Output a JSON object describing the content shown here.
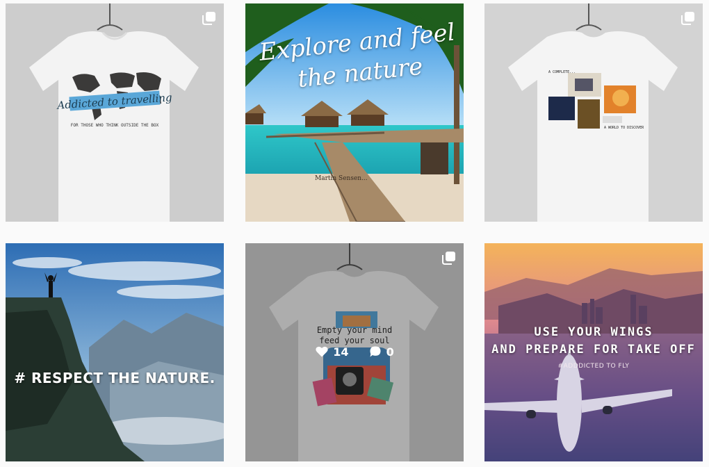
{
  "grid": {
    "posts": [
      {
        "id": "post-1",
        "overlay_title": "Addicted to travelling",
        "overlay_subtitle": "FOR THOSE WHO THINK OUTSIDE THE BOX",
        "multiple_images": true,
        "multi_icon": "carousel-icon"
      },
      {
        "id": "post-2",
        "overlay_title_line1": "Explore and feel",
        "overlay_title_line2": "the nature",
        "credit": "Martin Sensen..."
      },
      {
        "id": "post-3",
        "multiple_images": true,
        "multi_icon": "carousel-icon",
        "tee_caption_top": "A COMPLETE...",
        "tee_caption_bottom": "A WORLD TO DISCOVER"
      },
      {
        "id": "post-4",
        "overlay_text": "# RESPECT  THE NATURE."
      },
      {
        "id": "post-5",
        "multiple_images": true,
        "multi_icon": "carousel-icon",
        "tee_line1": "Empty your mind",
        "tee_line2": "feed your soul",
        "likes": "14",
        "comments": "0",
        "like_icon": "heart-icon",
        "comment_icon": "comment-icon",
        "hovered": true
      },
      {
        "id": "post-6",
        "overlay_line1": "USE YOUR WINGS",
        "overlay_line2": "AND PREPARE FOR TAKE OFF",
        "hashtag": "#ADDDICTED TO FLY"
      }
    ]
  },
  "colors": {
    "page_bg": "#fafafa",
    "tee_bg": "#cfcfcf",
    "accent_blue": "#5aa7d8",
    "sunset_pink": "#c97aa0"
  }
}
